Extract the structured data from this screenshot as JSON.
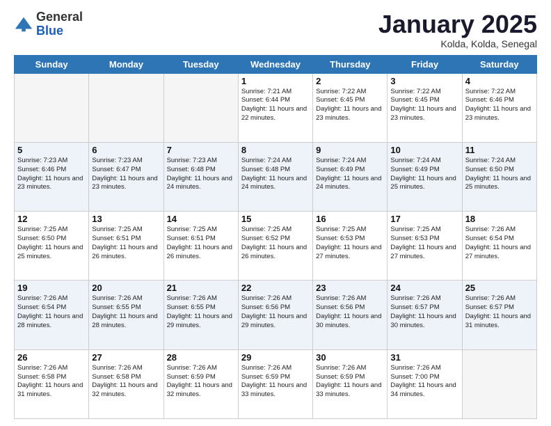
{
  "logo": {
    "general": "General",
    "blue": "Blue"
  },
  "header": {
    "month": "January 2025",
    "location": "Kolda, Kolda, Senegal"
  },
  "weekdays": [
    "Sunday",
    "Monday",
    "Tuesday",
    "Wednesday",
    "Thursday",
    "Friday",
    "Saturday"
  ],
  "weeks": [
    [
      {
        "day": "",
        "empty": true
      },
      {
        "day": "",
        "empty": true
      },
      {
        "day": "",
        "empty": true
      },
      {
        "day": "1",
        "sunrise": "7:21 AM",
        "sunset": "6:44 PM",
        "daylight": "11 hours and 22 minutes."
      },
      {
        "day": "2",
        "sunrise": "7:22 AM",
        "sunset": "6:45 PM",
        "daylight": "11 hours and 23 minutes."
      },
      {
        "day": "3",
        "sunrise": "7:22 AM",
        "sunset": "6:45 PM",
        "daylight": "11 hours and 23 minutes."
      },
      {
        "day": "4",
        "sunrise": "7:22 AM",
        "sunset": "6:46 PM",
        "daylight": "11 hours and 23 minutes."
      }
    ],
    [
      {
        "day": "5",
        "sunrise": "7:23 AM",
        "sunset": "6:46 PM",
        "daylight": "11 hours and 23 minutes."
      },
      {
        "day": "6",
        "sunrise": "7:23 AM",
        "sunset": "6:47 PM",
        "daylight": "11 hours and 23 minutes."
      },
      {
        "day": "7",
        "sunrise": "7:23 AM",
        "sunset": "6:48 PM",
        "daylight": "11 hours and 24 minutes."
      },
      {
        "day": "8",
        "sunrise": "7:24 AM",
        "sunset": "6:48 PM",
        "daylight": "11 hours and 24 minutes."
      },
      {
        "day": "9",
        "sunrise": "7:24 AM",
        "sunset": "6:49 PM",
        "daylight": "11 hours and 24 minutes."
      },
      {
        "day": "10",
        "sunrise": "7:24 AM",
        "sunset": "6:49 PM",
        "daylight": "11 hours and 25 minutes."
      },
      {
        "day": "11",
        "sunrise": "7:24 AM",
        "sunset": "6:50 PM",
        "daylight": "11 hours and 25 minutes."
      }
    ],
    [
      {
        "day": "12",
        "sunrise": "7:25 AM",
        "sunset": "6:50 PM",
        "daylight": "11 hours and 25 minutes."
      },
      {
        "day": "13",
        "sunrise": "7:25 AM",
        "sunset": "6:51 PM",
        "daylight": "11 hours and 26 minutes."
      },
      {
        "day": "14",
        "sunrise": "7:25 AM",
        "sunset": "6:51 PM",
        "daylight": "11 hours and 26 minutes."
      },
      {
        "day": "15",
        "sunrise": "7:25 AM",
        "sunset": "6:52 PM",
        "daylight": "11 hours and 26 minutes."
      },
      {
        "day": "16",
        "sunrise": "7:25 AM",
        "sunset": "6:53 PM",
        "daylight": "11 hours and 27 minutes."
      },
      {
        "day": "17",
        "sunrise": "7:25 AM",
        "sunset": "6:53 PM",
        "daylight": "11 hours and 27 minutes."
      },
      {
        "day": "18",
        "sunrise": "7:26 AM",
        "sunset": "6:54 PM",
        "daylight": "11 hours and 27 minutes."
      }
    ],
    [
      {
        "day": "19",
        "sunrise": "7:26 AM",
        "sunset": "6:54 PM",
        "daylight": "11 hours and 28 minutes."
      },
      {
        "day": "20",
        "sunrise": "7:26 AM",
        "sunset": "6:55 PM",
        "daylight": "11 hours and 28 minutes."
      },
      {
        "day": "21",
        "sunrise": "7:26 AM",
        "sunset": "6:55 PM",
        "daylight": "11 hours and 29 minutes."
      },
      {
        "day": "22",
        "sunrise": "7:26 AM",
        "sunset": "6:56 PM",
        "daylight": "11 hours and 29 minutes."
      },
      {
        "day": "23",
        "sunrise": "7:26 AM",
        "sunset": "6:56 PM",
        "daylight": "11 hours and 30 minutes."
      },
      {
        "day": "24",
        "sunrise": "7:26 AM",
        "sunset": "6:57 PM",
        "daylight": "11 hours and 30 minutes."
      },
      {
        "day": "25",
        "sunrise": "7:26 AM",
        "sunset": "6:57 PM",
        "daylight": "11 hours and 31 minutes."
      }
    ],
    [
      {
        "day": "26",
        "sunrise": "7:26 AM",
        "sunset": "6:58 PM",
        "daylight": "11 hours and 31 minutes."
      },
      {
        "day": "27",
        "sunrise": "7:26 AM",
        "sunset": "6:58 PM",
        "daylight": "11 hours and 32 minutes."
      },
      {
        "day": "28",
        "sunrise": "7:26 AM",
        "sunset": "6:59 PM",
        "daylight": "11 hours and 32 minutes."
      },
      {
        "day": "29",
        "sunrise": "7:26 AM",
        "sunset": "6:59 PM",
        "daylight": "11 hours and 33 minutes."
      },
      {
        "day": "30",
        "sunrise": "7:26 AM",
        "sunset": "6:59 PM",
        "daylight": "11 hours and 33 minutes."
      },
      {
        "day": "31",
        "sunrise": "7:26 AM",
        "sunset": "7:00 PM",
        "daylight": "11 hours and 34 minutes."
      },
      {
        "day": "",
        "empty": true
      }
    ]
  ],
  "labels": {
    "sunrise": "Sunrise: ",
    "sunset": "Sunset: ",
    "daylight": "Daylight: "
  }
}
